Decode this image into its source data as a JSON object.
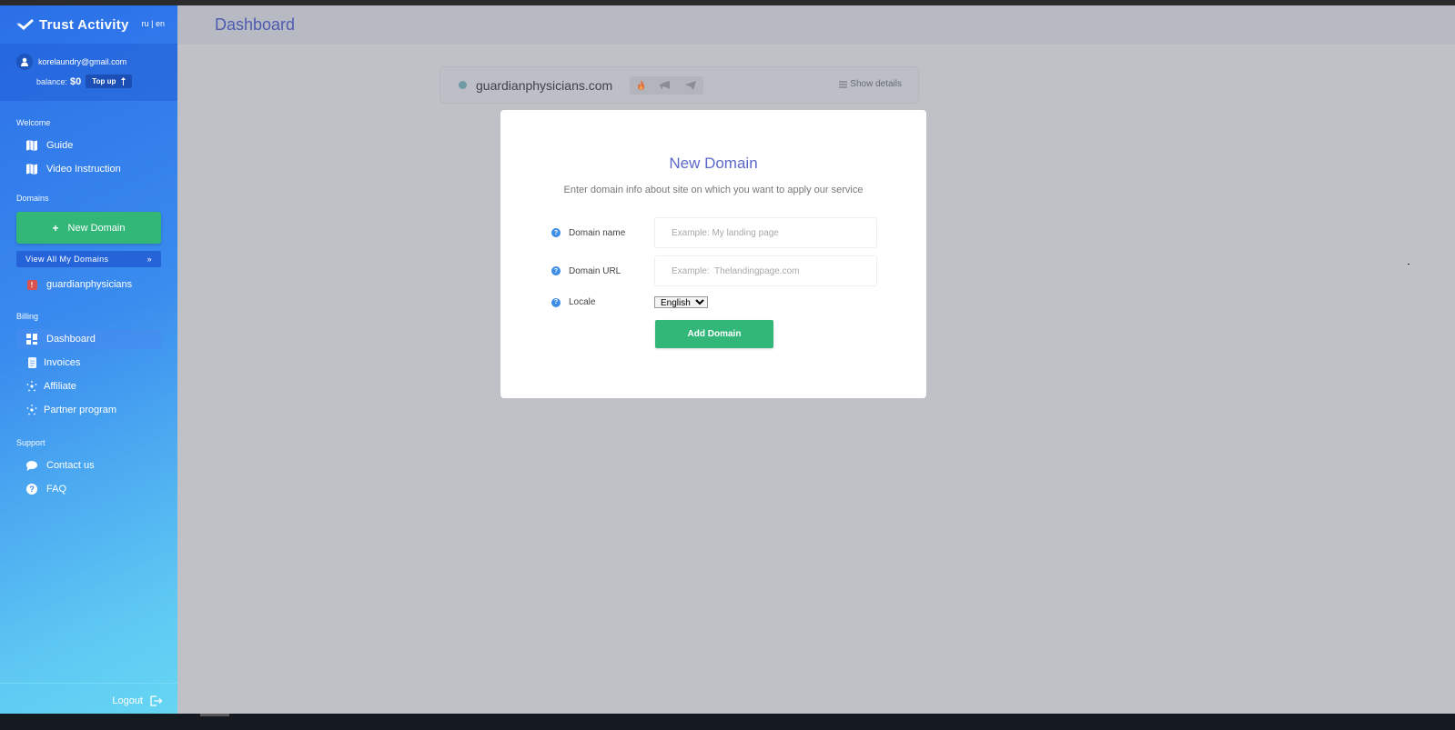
{
  "brand": {
    "name": "Trust Activity",
    "lang_switch": "ru | en"
  },
  "user": {
    "email": "korelaundry@gmail.com",
    "balance_label": "balance:",
    "balance_value": "$0",
    "topup_label": "Top up",
    "topup_icon": "arrow-up-icon"
  },
  "sidebar": {
    "sections": {
      "welcome": "Welcome",
      "domains": "Domains",
      "billing": "Billing",
      "support": "Support"
    },
    "welcome_items": [
      {
        "label": "Guide",
        "icon": "map-icon"
      },
      {
        "label": "Video Instruction",
        "icon": "map-icon"
      }
    ],
    "new_domain_label": "New Domain",
    "view_all_label": "View All My Domains",
    "view_all_arrow": "»",
    "domain_items": [
      {
        "label": "guardianphysicians",
        "badge": "!",
        "status_color": "#d9534f"
      }
    ],
    "billing_items": [
      {
        "label": "Dashboard",
        "icon": "dashboard-icon",
        "active": true
      },
      {
        "label": "Invoices",
        "icon": "invoice-icon"
      },
      {
        "label": "Affiliate",
        "icon": "network-icon"
      },
      {
        "label": "Partner program",
        "icon": "network-icon"
      }
    ],
    "support_items": [
      {
        "label": "Contact us",
        "icon": "chat-icon"
      },
      {
        "label": "FAQ",
        "icon": "question-icon",
        "glyph": "?"
      }
    ],
    "logout_label": "Logout"
  },
  "header": {
    "title": "Dashboard"
  },
  "domain_card": {
    "domain": "guardianphysicians.com",
    "actions": [
      "fire-icon",
      "megaphone-icon",
      "paper-plane-icon"
    ],
    "show_details_label": "Show details"
  },
  "modal": {
    "title": "New Domain",
    "subtitle": "Enter domain info about site on which you want to apply our service",
    "fields": {
      "domain_name": {
        "label": "Domain name",
        "value": "",
        "placeholder": "Example: My landing page",
        "help": "?"
      },
      "domain_url": {
        "label": "Domain URL",
        "value": "",
        "placeholder": "Example:  Thelandingpage.com",
        "help": "?"
      },
      "locale": {
        "label": "Locale",
        "selected": "English",
        "help": "?"
      }
    },
    "submit_label": "Add Domain"
  },
  "colors": {
    "accent": "#5b68c9",
    "success": "#32b779",
    "sidebar_start": "#2b6fe8",
    "sidebar_end": "#66d6f3",
    "danger": "#d9534f"
  }
}
